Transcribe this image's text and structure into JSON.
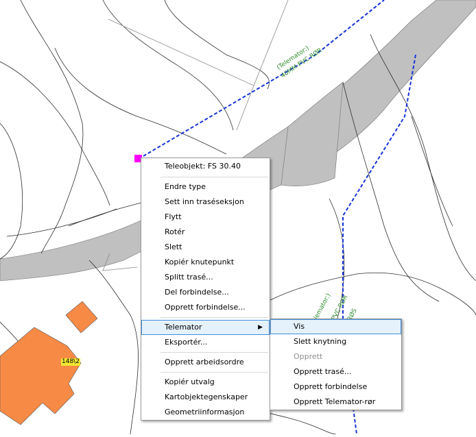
{
  "map": {
    "labels": {
      "telemator_top": "(Telemator:)",
      "pipe_top": "40MM PVC RØR",
      "telemator_mid": "(Telemator:)",
      "pipe_mid_a": "PVC RØR",
      "pipe_mid_b": "RØS",
      "building": "148\\2"
    },
    "colors": {
      "road": "#c0c0c0",
      "building": "#f78a45",
      "cable": "#1432d8",
      "node": "#ff00ff",
      "label_text": "#2e8b2e"
    }
  },
  "context_menu": {
    "header": "Teleobjekt: FS 30.40",
    "items": [
      "Endre type",
      "Sett inn traséseksjon",
      "Flytt",
      "Rotér",
      "Slett",
      "Kopiér knutepunkt",
      "Splitt trasé...",
      "Del forbindelse...",
      "Opprett forbindelse..."
    ],
    "telemator": "Telemator",
    "export": "Eksportér...",
    "work_order": "Opprett arbeidsordre",
    "bottom": [
      "Kopiér utvalg",
      "Kartobjektegenskaper",
      "Geometriinformasjon"
    ]
  },
  "submenu": {
    "items": [
      "Vis",
      "Slett knytning",
      "Opprett",
      "Opprett trasé...",
      "Opprett forbindelse",
      "Opprett Telemator-rør"
    ],
    "disabled": "Opprett"
  }
}
